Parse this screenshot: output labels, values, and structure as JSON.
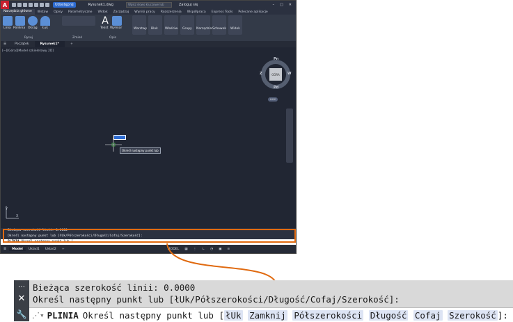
{
  "app": {
    "logo_letter": "A",
    "share_label": "Udostępnij",
    "document_title": "Rysunek1.dwg",
    "search_placeholder": "Wpisz słowo kluczowe lub frazę",
    "signin_label": "Zaloguj się"
  },
  "menu_tabs": [
    "Narzędzia główne",
    "Wstaw",
    "Opisy",
    "Parametryczne",
    "Widok",
    "Zarządzaj",
    "Wyniki pracy",
    "Rozszerzenia",
    "Współpraca",
    "Express Tools",
    "Polecane aplikacje"
  ],
  "ribbon": {
    "draw_tools": [
      "Linia",
      "Polilinia",
      "Okrąg",
      "Łuk"
    ],
    "text_tool": "Tekst",
    "dim_tool": "Wymiar",
    "big_buttons": [
      "Warstwy",
      "Blok",
      "Właściw.",
      "Grupy",
      "Narzędzia",
      "Schowek",
      "Widok"
    ],
    "panel_labels": [
      "Rysuj",
      "Zmień",
      "Opis"
    ]
  },
  "doc_tabs": [
    "Początek",
    "Rysunek1*"
  ],
  "viewport": {
    "label": "[−][Góra][Model szkieletowy 2D]",
    "cube_top": "GÓRA",
    "dir_n": "Pn",
    "dir_s": "Pd",
    "dir_w": "W",
    "dir_e": "Z",
    "wcs": "LUW",
    "tooltip": "Określ następny punkt lub",
    "ucs_y": "Y",
    "ucs_x": "X"
  },
  "command_line": {
    "history_1": "Bieżąca szerokość linii: 0.0000",
    "history_2": "Określ następny punkt lub [łUk/Półszerokości/Długość/Cofaj/Szerokość]:",
    "command": "PLINIA",
    "prompt": "Określ następny punkt lub [",
    "options": [
      "łUk",
      "Zamknij",
      "Półszerokości",
      "Długość",
      "Cofaj",
      "Szerokość"
    ],
    "closing": "]:"
  },
  "status_bar": {
    "layout_tabs": [
      "Model",
      "Układ1",
      "Układ2"
    ],
    "model_label": "MODEL"
  },
  "colors": {
    "callout": "#e06a10",
    "app_bg": "#1e2330",
    "option_highlight": "#dde4f4"
  }
}
